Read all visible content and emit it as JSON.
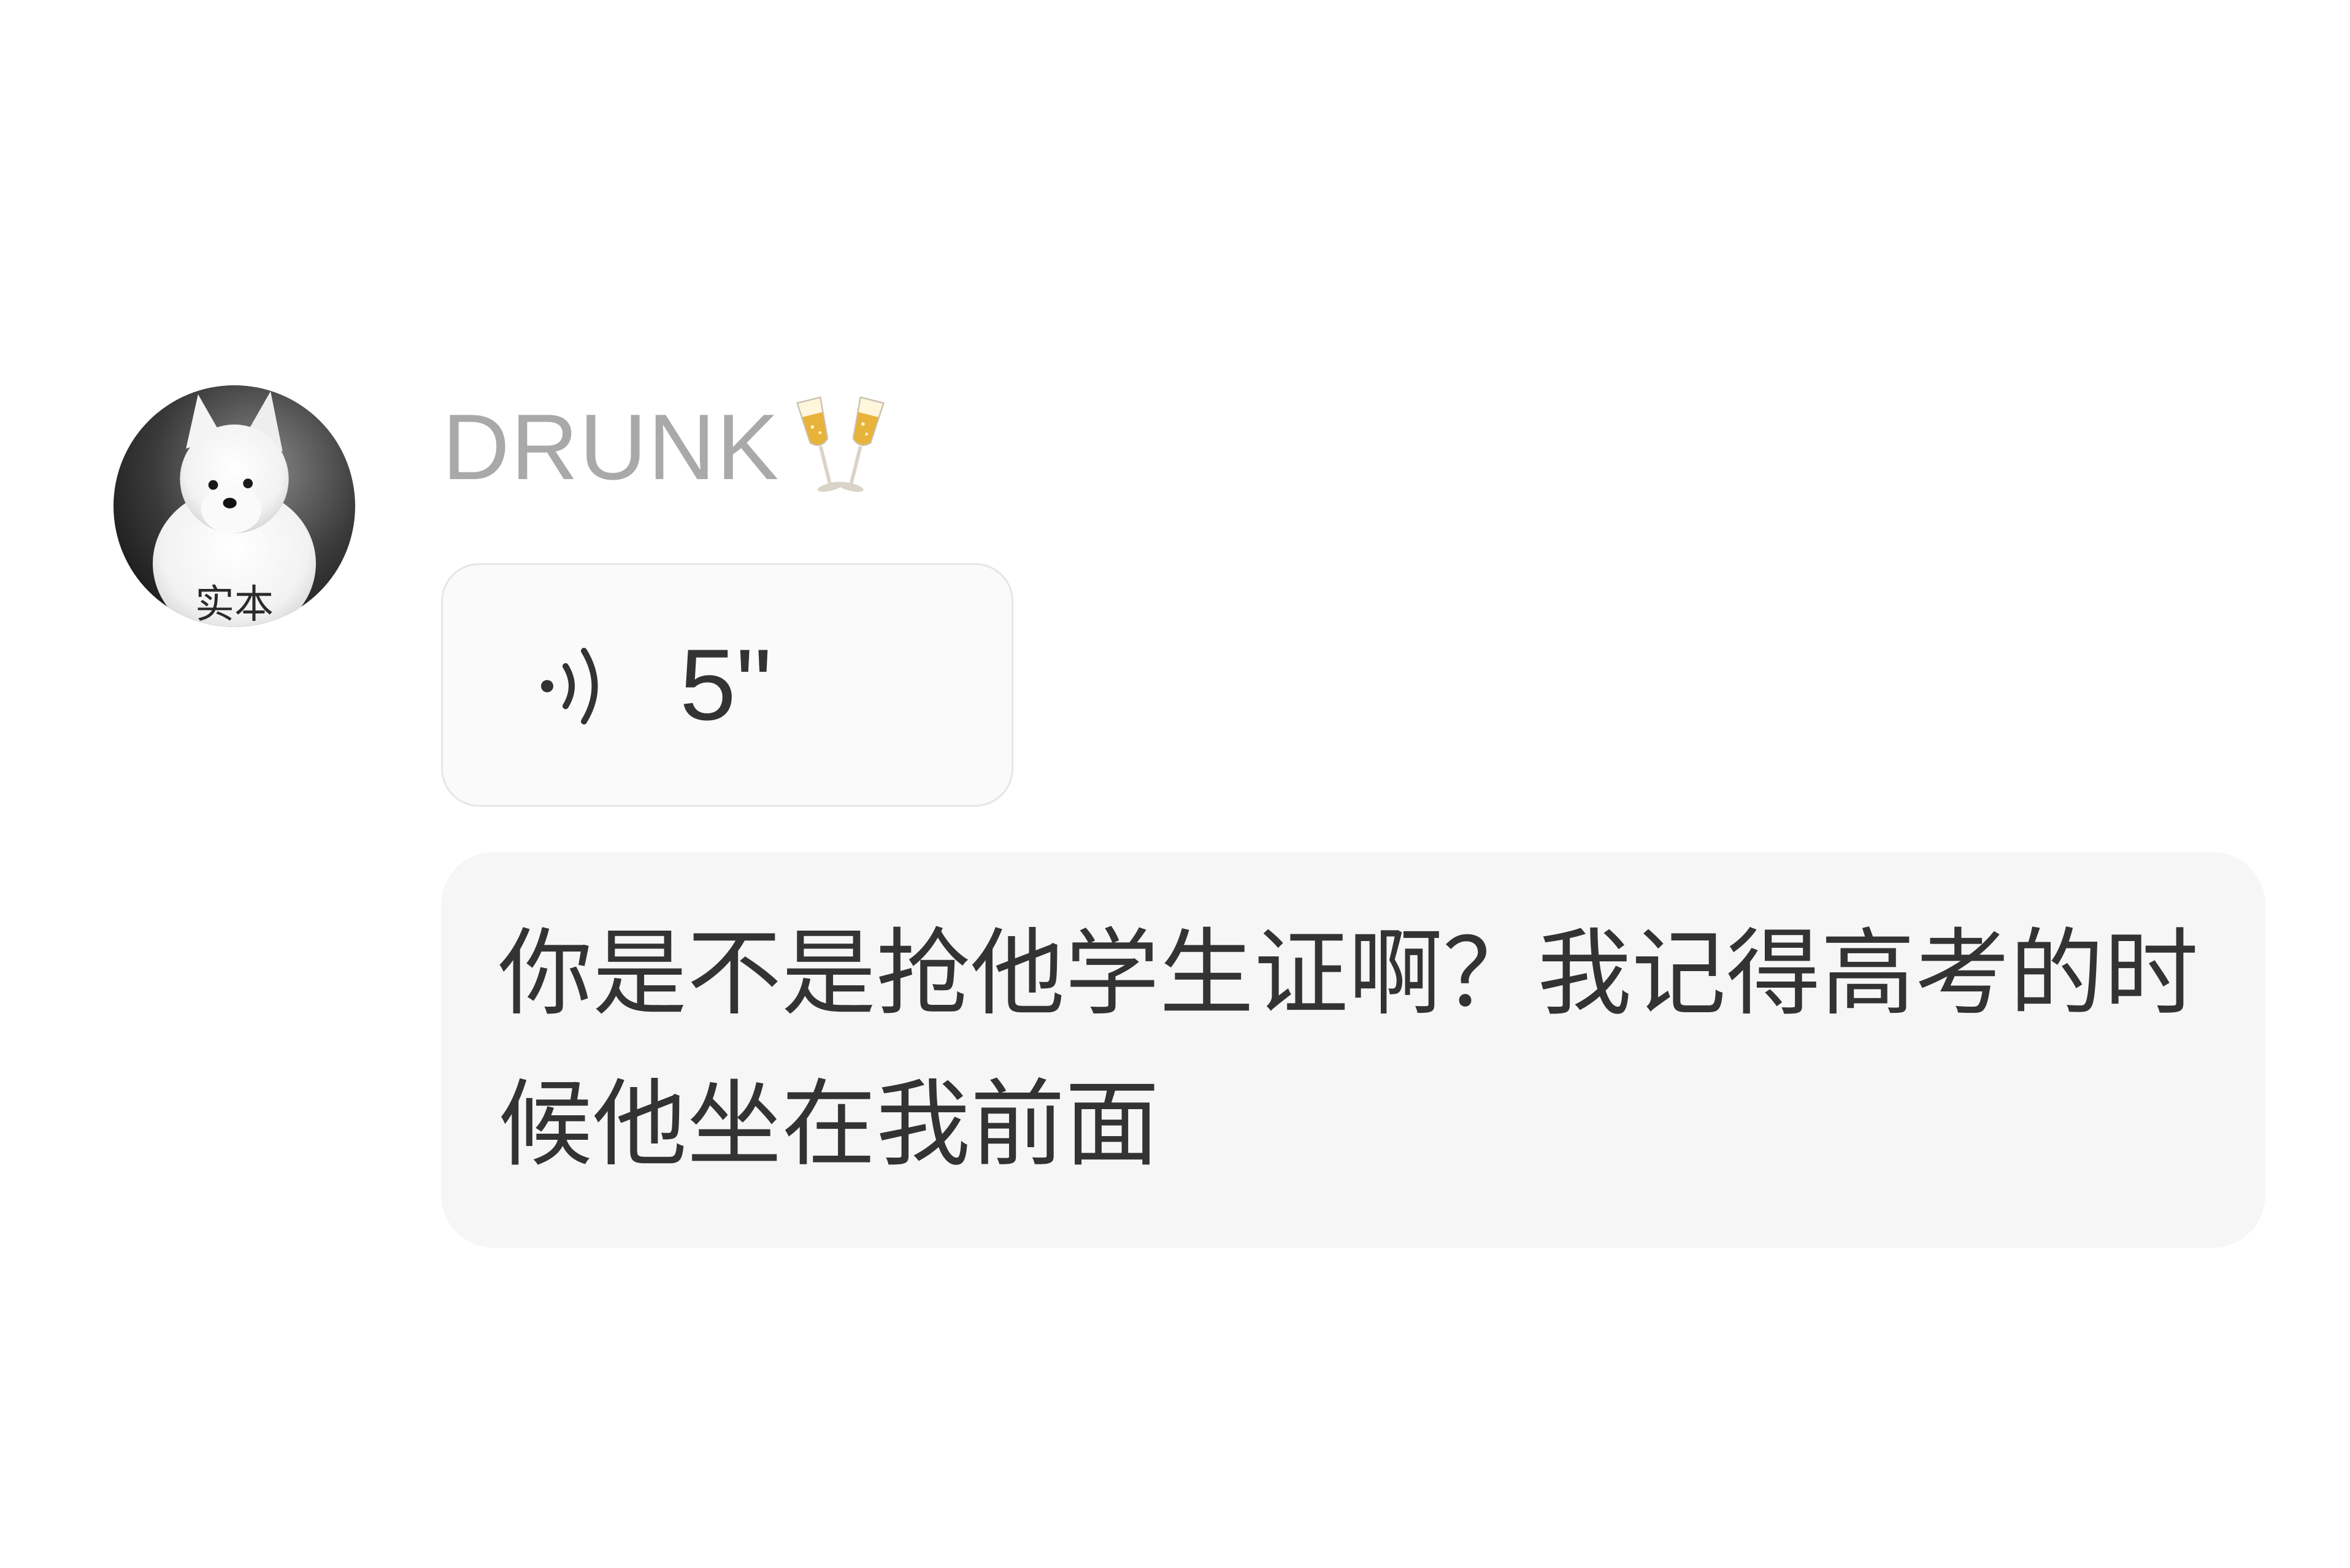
{
  "sender": {
    "name": "DRUNK",
    "name_icon": "clinking-glasses-icon",
    "avatar_caption": "实本"
  },
  "messages": [
    {
      "type": "voice",
      "icon": "voice-wave-icon",
      "duration": "5\""
    },
    {
      "type": "text",
      "text": "你是不是抢他学生证啊？我记得高考的时候他坐在我前面"
    }
  ],
  "colors": {
    "name_text": "#a9a9a9",
    "message_text": "#333333",
    "bubble_background": "#f6f6f6",
    "voice_bubble_border": "#e6e6e6"
  }
}
